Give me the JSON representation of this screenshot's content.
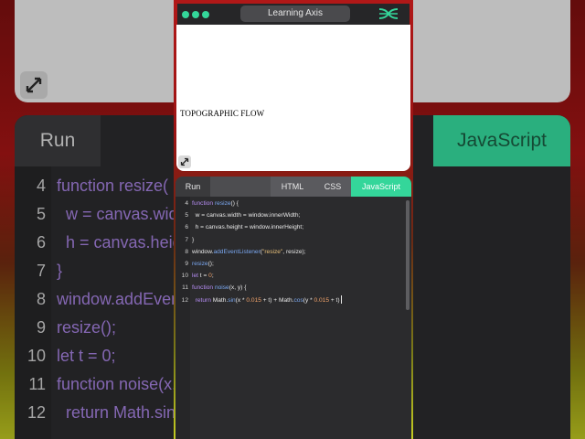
{
  "app": {
    "title": "Learning Axis"
  },
  "preview": {
    "canvas_text": "TOPOGRAPHIC FLOW"
  },
  "editor": {
    "tabs": {
      "run": "Run",
      "html": "HTML",
      "css": "CSS",
      "javascript": "JavaScript"
    },
    "active_tab": "JavaScript",
    "lines": [
      {
        "n": "4",
        "code": "function resize() {"
      },
      {
        "n": "5",
        "code": "  w = canvas.width = window.innerWidth;"
      },
      {
        "n": "6",
        "code": "  h = canvas.height = window.innerHeight;"
      },
      {
        "n": "7",
        "code": "}"
      },
      {
        "n": "8",
        "code": "window.addEventListener(\"resize\", resize);"
      },
      {
        "n": "9",
        "code": "resize();"
      },
      {
        "n": "10",
        "code": "let t = 0;"
      },
      {
        "n": "11",
        "code": "function noise(x, y) {"
      },
      {
        "n": "12",
        "code": "  return Math.sin(x * 0.015 + t) + Math.cos(y * 0.015 + t)"
      }
    ]
  },
  "background": {
    "run": "Run",
    "javascript": "JavaScript",
    "lines": [
      {
        "n": "4",
        "code": "function resize("
      },
      {
        "n": "5",
        "code": "  w = canvas.wid"
      },
      {
        "n": "6",
        "code": "  h = canvas.heig"
      },
      {
        "n": "7",
        "code": "}"
      },
      {
        "n": "8",
        "code": "window.addEven"
      },
      {
        "n": "9",
        "code": "resize();"
      },
      {
        "n": "10",
        "code": "let t = 0;"
      },
      {
        "n": "11",
        "code": "function noise(x,"
      },
      {
        "n": "12",
        "code": "  return Math.sin"
      }
    ]
  },
  "colors": {
    "accent": "#34d69a",
    "frame_top": "#b01818",
    "frame_bottom": "#c4cc22",
    "editor_bg": "#2b2b2d"
  }
}
